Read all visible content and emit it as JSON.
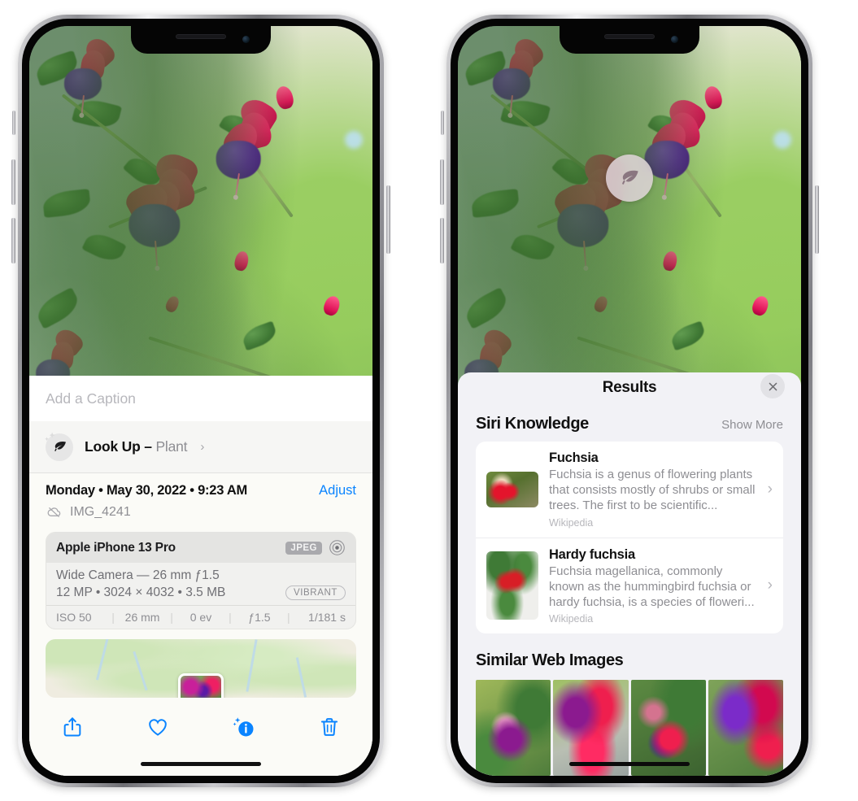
{
  "left_phone": {
    "caption": {
      "placeholder": "Add a Caption",
      "value": ""
    },
    "lookup": {
      "label": "Look Up – ",
      "subject": "Plant",
      "chevron": "›",
      "icon": "leaf-icon"
    },
    "date": {
      "text": "Monday • May 30, 2022 • 9:23 AM",
      "adjust_label": "Adjust"
    },
    "filename": {
      "text": "IMG_4241",
      "icon": "icloud-slash-icon"
    },
    "exif": {
      "device": "Apple iPhone 13 Pro",
      "format_badge": "JPEG",
      "lens_icon": "lens-icon",
      "line1": "Wide Camera — 26 mm ƒ1.5",
      "line2": "12 MP • 3024 × 4032 • 3.5 MB",
      "style_badge": "VIBRANT",
      "stats": [
        "ISO 50",
        "26 mm",
        "0 ev",
        "ƒ1.5",
        "1/181 s"
      ]
    },
    "toolbar": [
      {
        "name": "share-button",
        "icon": "share-icon"
      },
      {
        "name": "favorite-button",
        "icon": "heart-icon"
      },
      {
        "name": "info-button",
        "icon": "info-sparkle-icon"
      },
      {
        "name": "delete-button",
        "icon": "trash-icon"
      }
    ],
    "accent_color": "#0a84ff"
  },
  "right_phone": {
    "visual_lookup_badge": {
      "icon": "leaf-icon"
    },
    "sheet": {
      "title": "Results",
      "close_icon": "close-icon"
    },
    "siri_knowledge": {
      "title": "Siri Knowledge",
      "show_more": "Show More",
      "items": [
        {
          "name": "Fuchsia",
          "description": "Fuchsia is a genus of flowering plants that consists mostly of shrubs or small trees. The first to be scientific...",
          "source": "Wikipedia",
          "chevron": "›"
        },
        {
          "name": "Hardy fuchsia",
          "description": "Fuchsia magellanica, commonly known as the hummingbird fuchsia or hardy fuchsia, is a species of floweri...",
          "source": "Wikipedia",
          "chevron": "›"
        }
      ]
    },
    "similar_web_images": {
      "title": "Similar Web Images",
      "thumbnails": [
        "fuchsia-pink-purple",
        "fuchsia-red-closeup",
        "fuchsia-bush",
        "fuchsia-purple-magenta"
      ]
    }
  }
}
